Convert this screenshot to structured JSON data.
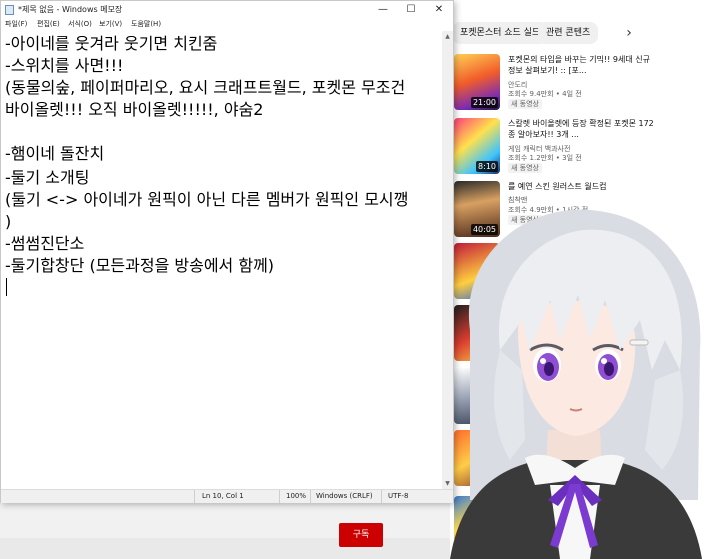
{
  "notepad": {
    "title": "*제목 없음 - Windows 메모장",
    "controls": {
      "minimize": "—",
      "maximize": "☐",
      "close": "✕"
    },
    "menu": [
      "파일(F)",
      "편집(E)",
      "서식(O)",
      "보기(V)",
      "도움말(H)"
    ],
    "lines": [
      "-아이네를 웃겨라 웃기면 치킨줌",
      "-스위치를 사면!!!",
      "(동물의숲, 페이퍼마리오, 요시 크래프트월드, 포켓몬 무조건",
      "바이올렛!!! 오직 바이올렛!!!!!, 야숨2",
      "",
      "-햄이네 돌잔치",
      "-둘기 소개팅",
      "(둘기 <-> 아이네가 원픽이 아닌 다른 멤버가 원픽인 모시깽",
      ")",
      "-썸썸진단소",
      "-둘기합창단 (모든과정을 방송에서 함께)"
    ],
    "status": {
      "position": "Ln 10, Col 1",
      "zoom": "100%",
      "line_ending": "Windows (CRLF)",
      "encoding": "UTF-8"
    }
  },
  "youtube": {
    "chips": [
      "포켓몬스터 쇼드 실드",
      "관련 콘텐츠"
    ],
    "next_chip": "›",
    "videos": [
      {
        "title": "포켓몬의 타입을 바꾸는 기믹!! 9세대 신규 정보 살펴보기! :: [포...",
        "channel": "안도리",
        "meta": "조회수 9.4만회 • 4일 전",
        "badge": "새 동영상",
        "duration": "21:00"
      },
      {
        "title": "스칼렛 바이올렛에 등장 확정된 포켓몬 172종 알아보자!! 3개 ...",
        "channel": "게임 캐릭터 백과사전",
        "meta": "조회수 1.2만회 • 3일 전",
        "badge": "새 동영상",
        "duration": "8:10"
      },
      {
        "title": "를 예연 스킨 원러스트 월드컵",
        "channel": "침착맨",
        "meta": "조회수 4.9만회 • 1시간 전",
        "badge": "새 동영상",
        "duration": "40:05"
      }
    ],
    "red_button": "구독"
  },
  "colors": {
    "chip_bg": "#f0f0f0",
    "youtube_red": "#cc0000",
    "notepad_status_bg": "#f0f0f0",
    "avatar_hair": "#e6e8ec",
    "avatar_eyes": "#8f4fd3",
    "avatar_ribbon": "#6b2fbf"
  },
  "icons": {
    "notepad_icon": "notepad-icon",
    "caret": "text-caret"
  }
}
